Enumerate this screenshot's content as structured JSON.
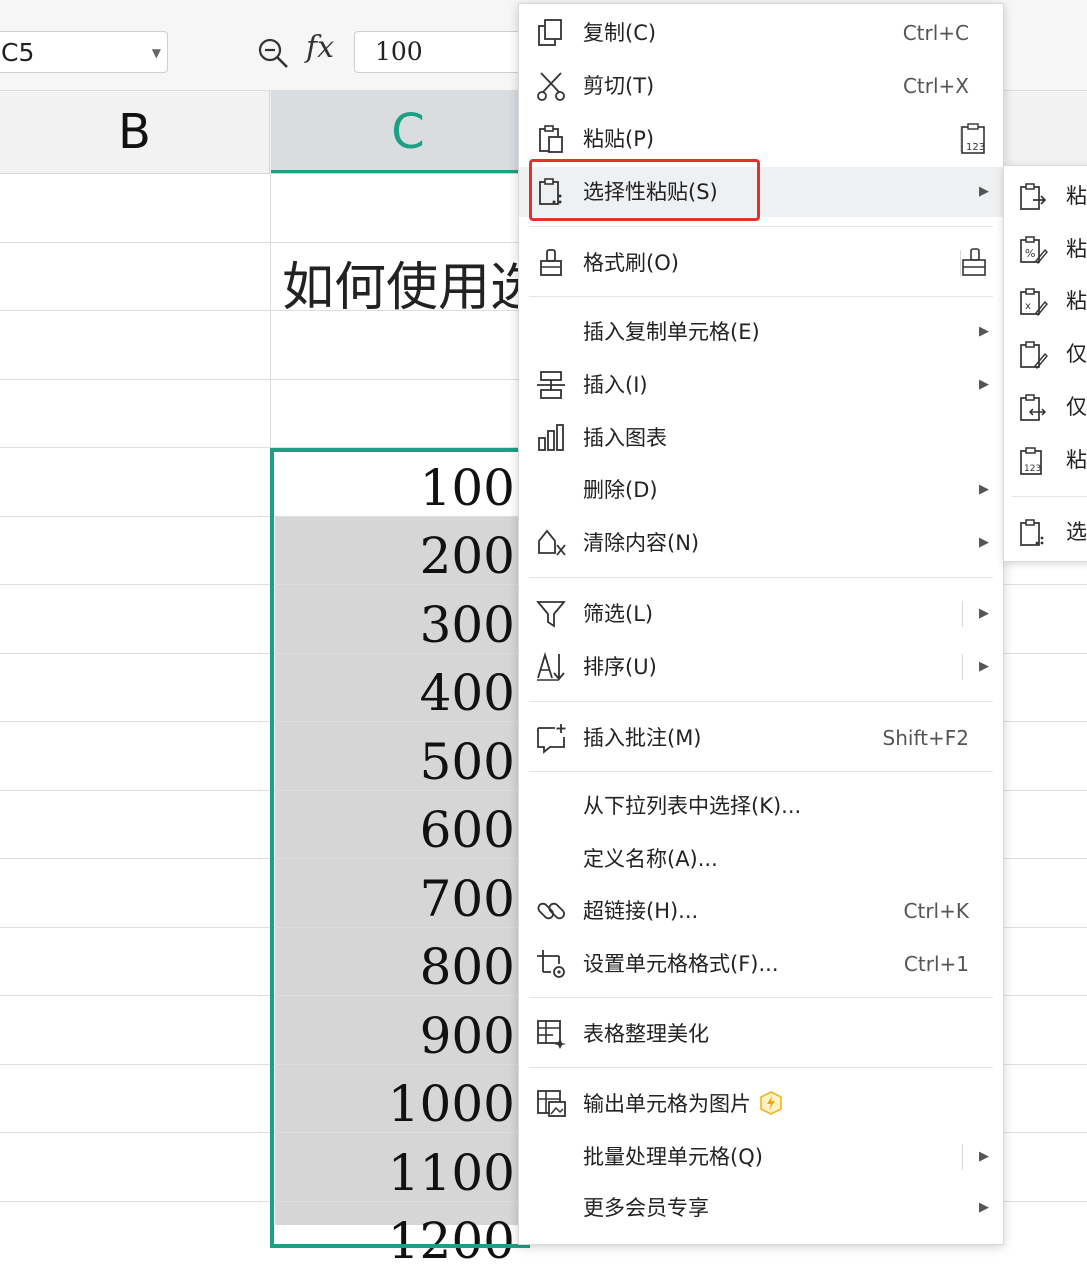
{
  "formula_bar": {
    "name_box": "C5",
    "fx_label": "fx",
    "formula_value": "100"
  },
  "columns": {
    "b": "B",
    "c": "C"
  },
  "sheet": {
    "title_cell": "如何使用选",
    "values": [
      "100",
      "200",
      "300",
      "400",
      "500",
      "600",
      "700",
      "800",
      "900",
      "1000",
      "1100",
      "1200"
    ]
  },
  "context_menu": {
    "copy": {
      "label": "复制(C)",
      "shortcut": "Ctrl+C"
    },
    "cut": {
      "label": "剪切(T)",
      "shortcut": "Ctrl+X"
    },
    "paste": {
      "label": "粘贴(P)"
    },
    "paste_special": {
      "label": "选择性粘贴(S)"
    },
    "format_painter": {
      "label": "格式刷(O)"
    },
    "insert_copied_cells": {
      "label": "插入复制单元格(E)"
    },
    "insert": {
      "label": "插入(I)"
    },
    "insert_chart": {
      "label": "插入图表"
    },
    "delete": {
      "label": "删除(D)"
    },
    "clear_contents": {
      "label": "清除内容(N)"
    },
    "filter": {
      "label": "筛选(L)"
    },
    "sort": {
      "label": "排序(U)"
    },
    "insert_comment": {
      "label": "插入批注(M)",
      "shortcut": "Shift+F2"
    },
    "pick_from_list": {
      "label": "从下拉列表中选择(K)..."
    },
    "define_name": {
      "label": "定义名称(A)..."
    },
    "hyperlink": {
      "label": "超链接(H)...",
      "shortcut": "Ctrl+K"
    },
    "format_cells": {
      "label": "设置单元格格式(F)...",
      "shortcut": "Ctrl+1"
    },
    "table_beautify": {
      "label": "表格整理美化"
    },
    "export_as_image": {
      "label": "输出单元格为图片"
    },
    "batch_process": {
      "label": "批量处理单元格(Q)"
    },
    "member_exclusive": {
      "label": "更多会员专享"
    }
  },
  "submenu": {
    "items": [
      "粘",
      "粘",
      "粘",
      "仅",
      "仅",
      "粘",
      "选"
    ]
  },
  "colors": {
    "selection_border": "#1f9e86",
    "highlight_box": "#e5312b",
    "column_c_header_text": "#1aa083",
    "selected_cell_fill": "#d6d6d6"
  },
  "icons": [
    "copy-icon",
    "cut-icon",
    "paste-icon",
    "paste-special-icon",
    "format-painter-icon",
    "insert-icon",
    "insert-chart-icon",
    "clear-icon",
    "filter-icon",
    "sort-icon",
    "comment-icon",
    "hyperlink-icon",
    "format-cells-icon",
    "beautify-icon",
    "export-image-icon",
    "vip-icon"
  ]
}
